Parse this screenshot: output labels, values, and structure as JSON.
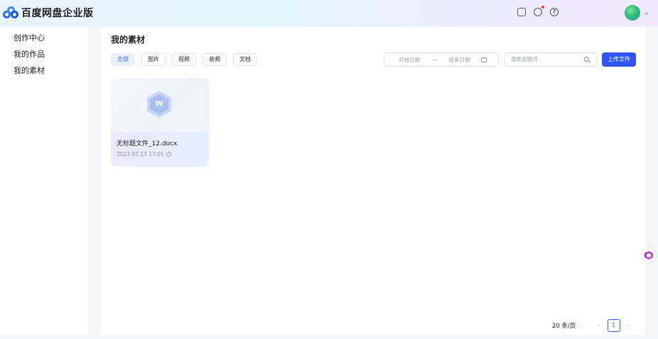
{
  "app": {
    "title": "百度网盘企业版"
  },
  "sidebar": {
    "items": [
      {
        "label": "创作中心"
      },
      {
        "label": "我的作品"
      },
      {
        "label": "我的素材"
      }
    ]
  },
  "header": {
    "icons": [
      "list-icon",
      "message-icon",
      "help-icon"
    ],
    "avatar": "user-avatar",
    "notification_color": "#ff3b30"
  },
  "main": {
    "title": "我的素材",
    "filters": [
      {
        "label": "全部",
        "active": true
      },
      {
        "label": "图片",
        "active": false
      },
      {
        "label": "视频",
        "active": false
      },
      {
        "label": "音频",
        "active": false
      },
      {
        "label": "文档",
        "active": false
      }
    ],
    "date_range": {
      "start_placeholder": "开始日期",
      "separator": "—",
      "end_placeholder": "结束日期"
    },
    "search": {
      "placeholder": "搜索关键词"
    },
    "upload_label": "上传文件",
    "files": [
      {
        "name": "无标题文件_12.docx",
        "date": "2023.07.13 17:01",
        "type_badge": "W"
      }
    ],
    "pagination": {
      "page_size": "20 条/页",
      "current_page": "1"
    }
  },
  "colors": {
    "accent": "#2f55ff",
    "active_chip_bg": "#e8efff"
  }
}
